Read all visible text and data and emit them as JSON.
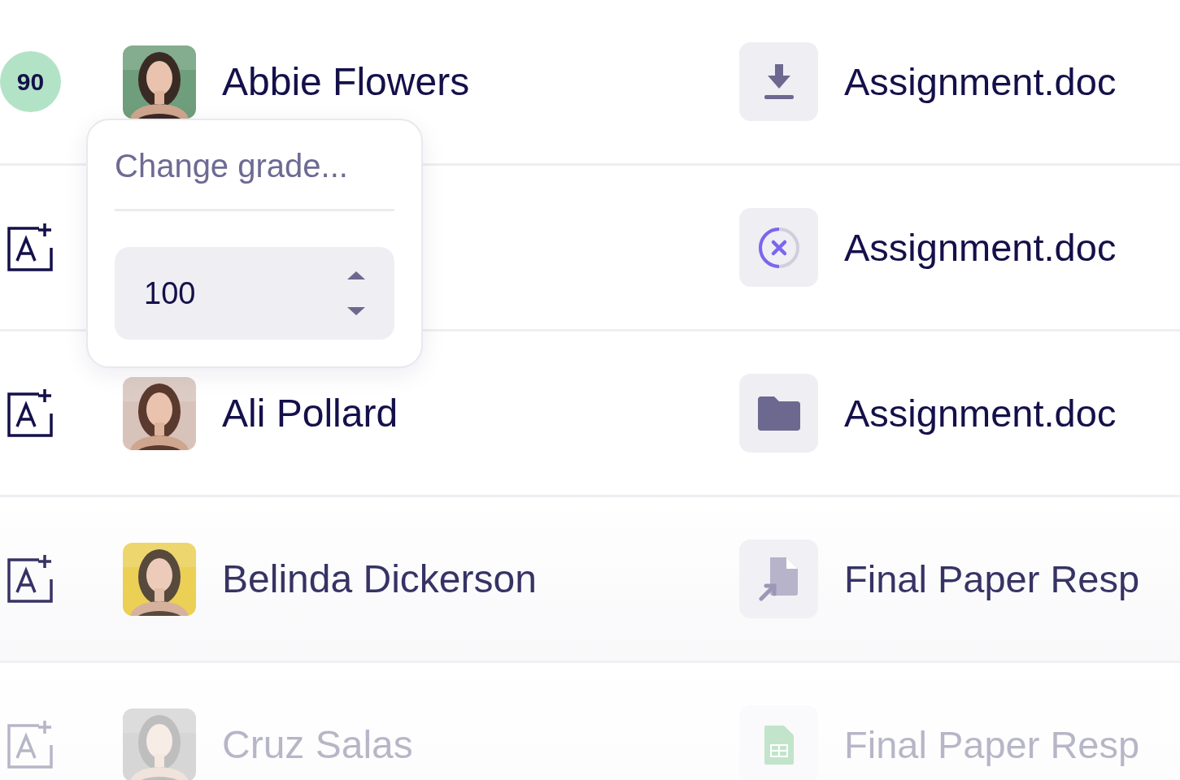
{
  "rows": [
    {
      "grade": {
        "kind": "graded",
        "value": "90"
      },
      "name": "Abbie Flowers",
      "file": {
        "kind": "download",
        "name": "Assignment.doc"
      }
    },
    {
      "grade": {
        "kind": "add"
      },
      "file": {
        "kind": "cancel",
        "name": "Assignment.doc"
      }
    },
    {
      "grade": {
        "kind": "add"
      },
      "name": "Ali Pollard",
      "file": {
        "kind": "folder",
        "name": "Assignment.doc"
      }
    },
    {
      "grade": {
        "kind": "add"
      },
      "name": "Belinda Dickerson",
      "file": {
        "kind": "import",
        "name": "Final Paper Resp"
      }
    },
    {
      "grade": {
        "kind": "add"
      },
      "name": "Cruz Salas",
      "file": {
        "kind": "sheet",
        "name": "Final Paper Resp"
      }
    }
  ],
  "popover": {
    "title": "Change grade...",
    "input": {
      "value": "100"
    }
  }
}
